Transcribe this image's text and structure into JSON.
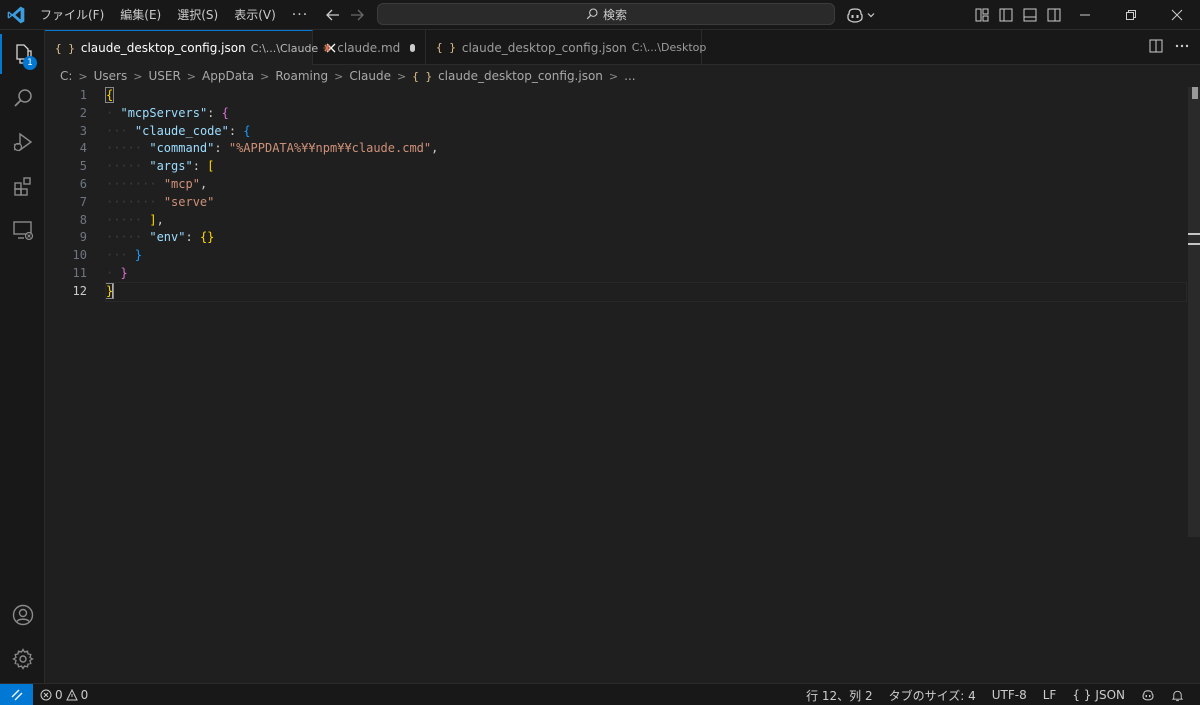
{
  "titlebar": {
    "menu": [
      "ファイル(F)",
      "編集(E)",
      "選択(S)",
      "表示(V)",
      "···"
    ],
    "search_label": "検索"
  },
  "activitybar": {
    "items": [
      {
        "icon": "explorer-icon",
        "badge": "1"
      },
      {
        "icon": "search-icon"
      },
      {
        "icon": "run-debug-icon"
      },
      {
        "icon": "extensions-icon"
      },
      {
        "icon": "remote-explorer-icon"
      }
    ],
    "bottom": [
      {
        "icon": "account-icon"
      },
      {
        "icon": "settings-gear-icon"
      }
    ]
  },
  "tabs": [
    {
      "name": "claude_desktop_config.json",
      "description": "C:\\...\\Claude",
      "active": true,
      "icon": "json-icon"
    },
    {
      "name": "claude.md",
      "modified": true,
      "icon": "claude-asterisk-icon"
    },
    {
      "name": "claude_desktop_config.json",
      "description": "C:\\...\\Desktop",
      "icon": "json-icon"
    }
  ],
  "breadcrumb": [
    "C:",
    "Users",
    "USER",
    "AppData",
    "Roaming",
    "Claude",
    "claude_desktop_config.json",
    "..."
  ],
  "json_icon_text": "{ }",
  "editor": {
    "line_numbers": [
      "1",
      "2",
      "3",
      "4",
      "5",
      "6",
      "7",
      "8",
      "9",
      "10",
      "11",
      "12"
    ],
    "active_line": 12,
    "tokens": {
      "open_brace": "{",
      "key_mcpServers": "\"mcpServers\"",
      "key_claude_code": "\"claude_code\"",
      "key_command": "\"command\"",
      "val_command": "\"%APPDATA%¥¥npm¥¥claude.cmd\"",
      "key_args": "\"args\"",
      "val_mcp": "\"mcp\"",
      "val_serve": "\"serve\"",
      "key_env": "\"env\"",
      "val_env": "{}",
      "close_brace": "}"
    }
  },
  "statusbar": {
    "errors": "0",
    "warnings": "0",
    "position": "行 12、列 2",
    "tab_size": "タブのサイズ: 4",
    "encoding": "UTF-8",
    "eol": "LF",
    "language": "JSON",
    "language_icon": "{ }"
  },
  "colors": {
    "accent": "#0078d4",
    "json_key": "#9cdcfe",
    "json_string": "#ce9178",
    "bracket_level1": "#ffd700",
    "bracket_level2": "#da70d6",
    "bracket_level3": "#179fff"
  }
}
